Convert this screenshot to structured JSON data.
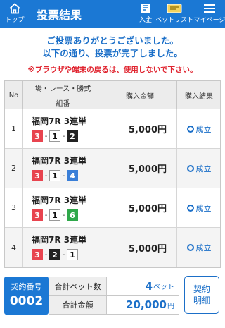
{
  "header": {
    "title": "投票結果",
    "top_label": "トップ",
    "deposit_label": "入金",
    "betlist_label": "ベットリスト",
    "mypage_label": "マイページ",
    "bg_color": "#1b78d4"
  },
  "messages": {
    "thanks": "ご投票ありがとうございました。",
    "completed": "以下の通り、投票が完了しました。",
    "warning": "※ブラウザや端末の戻るは、使用しないで下さい。"
  },
  "table": {
    "headers": {
      "no": "No",
      "race": "場・レース・勝式",
      "combination": "組番",
      "amount": "購入金額",
      "result": "購入結果"
    },
    "rows": [
      {
        "no": "1",
        "race": "福岡7R 3連単",
        "n1": "3",
        "n2": "1",
        "n3": "2",
        "amount": "5,000円",
        "result": "成立"
      },
      {
        "no": "2",
        "race": "福岡7R 3連単",
        "n1": "3",
        "n2": "1",
        "n3": "4",
        "amount": "5,000円",
        "result": "成立"
      },
      {
        "no": "3",
        "race": "福岡7R 3連単",
        "n1": "3",
        "n2": "1",
        "n3": "6",
        "amount": "5,000円",
        "result": "成立"
      },
      {
        "no": "4",
        "race": "福岡7R 3連単",
        "n1": "3",
        "n2": "2",
        "n3": "1",
        "amount": "5,000円",
        "result": "成立"
      }
    ],
    "separator": "-"
  },
  "footer": {
    "contract_label": "契約番号",
    "contract_number": "0002",
    "total_bets_label": "合計ベット数",
    "total_bets_value": "4",
    "total_bets_unit": "ベット",
    "total_amount_label": "合計金額",
    "total_amount_value": "20,000",
    "total_amount_unit": "円",
    "detail_button_line1": "契約",
    "detail_button_line2": "明細"
  }
}
